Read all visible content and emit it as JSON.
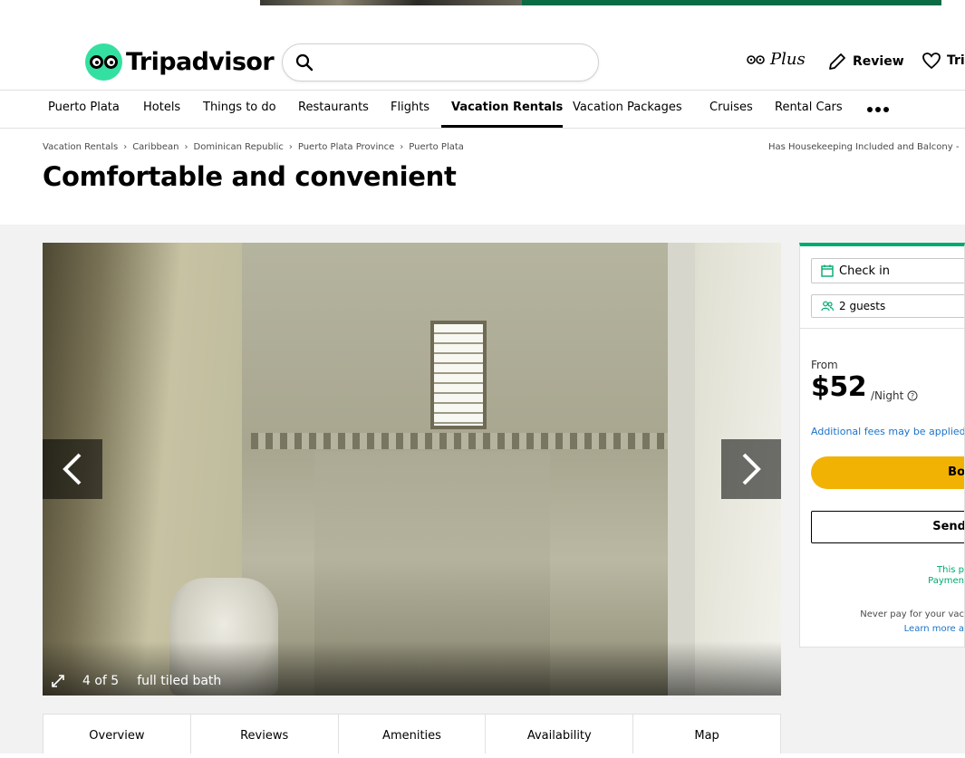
{
  "brand": {
    "name": "Tripadvisor",
    "accent": "#34e0a1"
  },
  "search": {
    "placeholder": ""
  },
  "header_links": {
    "plus": "Plus",
    "review": "Review",
    "trips": "Trips"
  },
  "nav": {
    "items": [
      "Puerto Plata",
      "Hotels",
      "Things to do",
      "Restaurants",
      "Flights",
      "Vacation Rentals",
      "Vacation Packages",
      "Cruises",
      "Rental Cars"
    ],
    "active": "Vacation Rentals"
  },
  "breadcrumb": [
    "Vacation Rentals",
    "Caribbean",
    "Dominican Republic",
    "Puerto Plata Province",
    "Puerto Plata"
  ],
  "breadcrumb_right": "Has Housekeeping Included and Balcony -",
  "page_title": "Comfortable and convenient",
  "photo": {
    "counter": "4 of 5",
    "caption": "full tiled bath"
  },
  "tabs": [
    "Overview",
    "Reviews",
    "Amenities",
    "Availability",
    "Map"
  ],
  "booking": {
    "checkin_label": "Check in",
    "guests_label": "2 guests",
    "from_label": "From",
    "price": "$52",
    "per_night": "/Night",
    "fees_note": "Additional fees may be applied",
    "book_button": "Bo",
    "send_button": "Send",
    "protect_line1": "This p",
    "protect_line2": "Paymen",
    "never_pay": "Never pay for your vac",
    "learn_more": "Learn more a"
  },
  "colors": {
    "book_button": "#f2b203",
    "panel_accent": "#00aa6c",
    "link": "#1a73c8"
  }
}
